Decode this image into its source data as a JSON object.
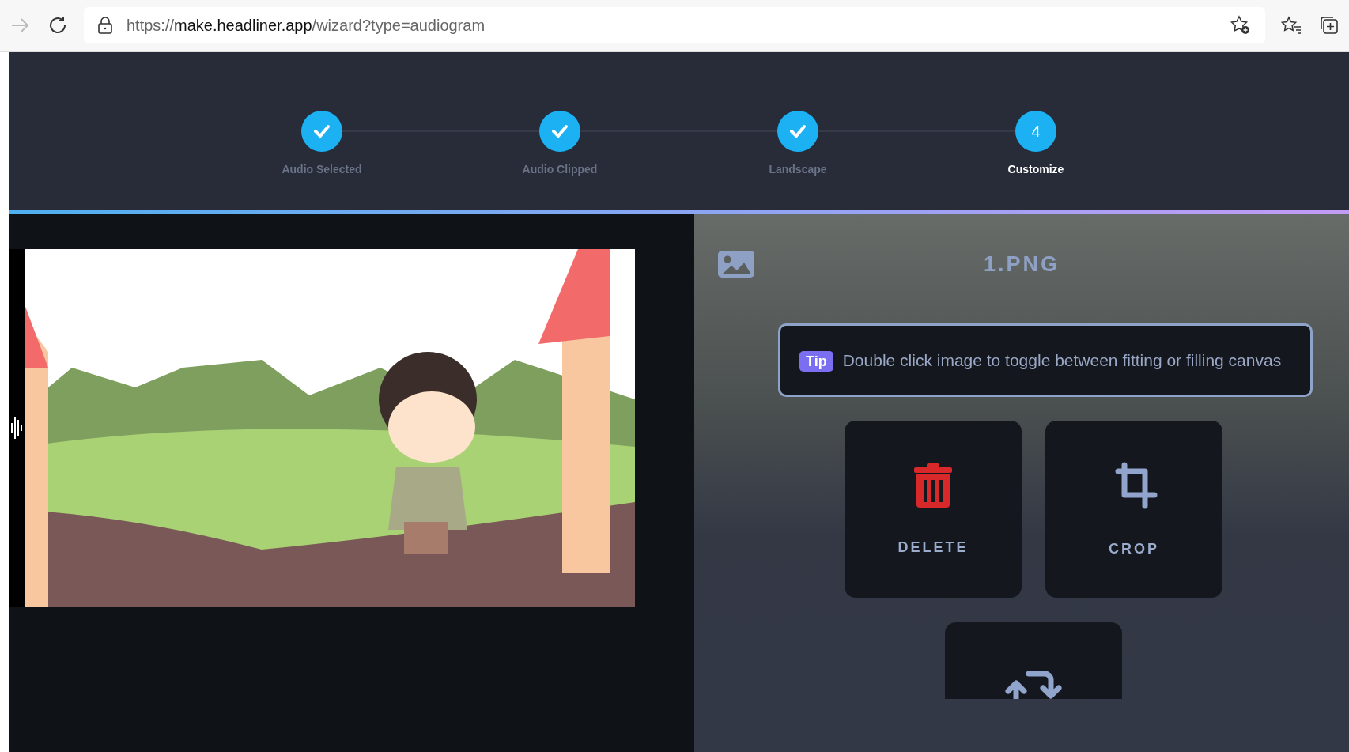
{
  "browser": {
    "url_scheme": "https://",
    "url_host": "make.headliner.app",
    "url_path": "/wizard?type=audiogram"
  },
  "steps": [
    {
      "label": "Audio Selected",
      "completed": true,
      "active": false
    },
    {
      "label": "Audio Clipped",
      "completed": true,
      "active": false
    },
    {
      "label": "Landscape",
      "completed": true,
      "active": false
    },
    {
      "label": "Customize",
      "completed": false,
      "active": true,
      "number": "4"
    }
  ],
  "panel": {
    "title": "1.PNG",
    "tip_badge": "Tip",
    "tip_text": "Double click image to toggle between fitting or filling canvas",
    "actions": [
      {
        "kind": "delete",
        "label": "DELETE"
      },
      {
        "kind": "crop",
        "label": "CROP"
      },
      {
        "kind": "swap"
      }
    ]
  }
}
